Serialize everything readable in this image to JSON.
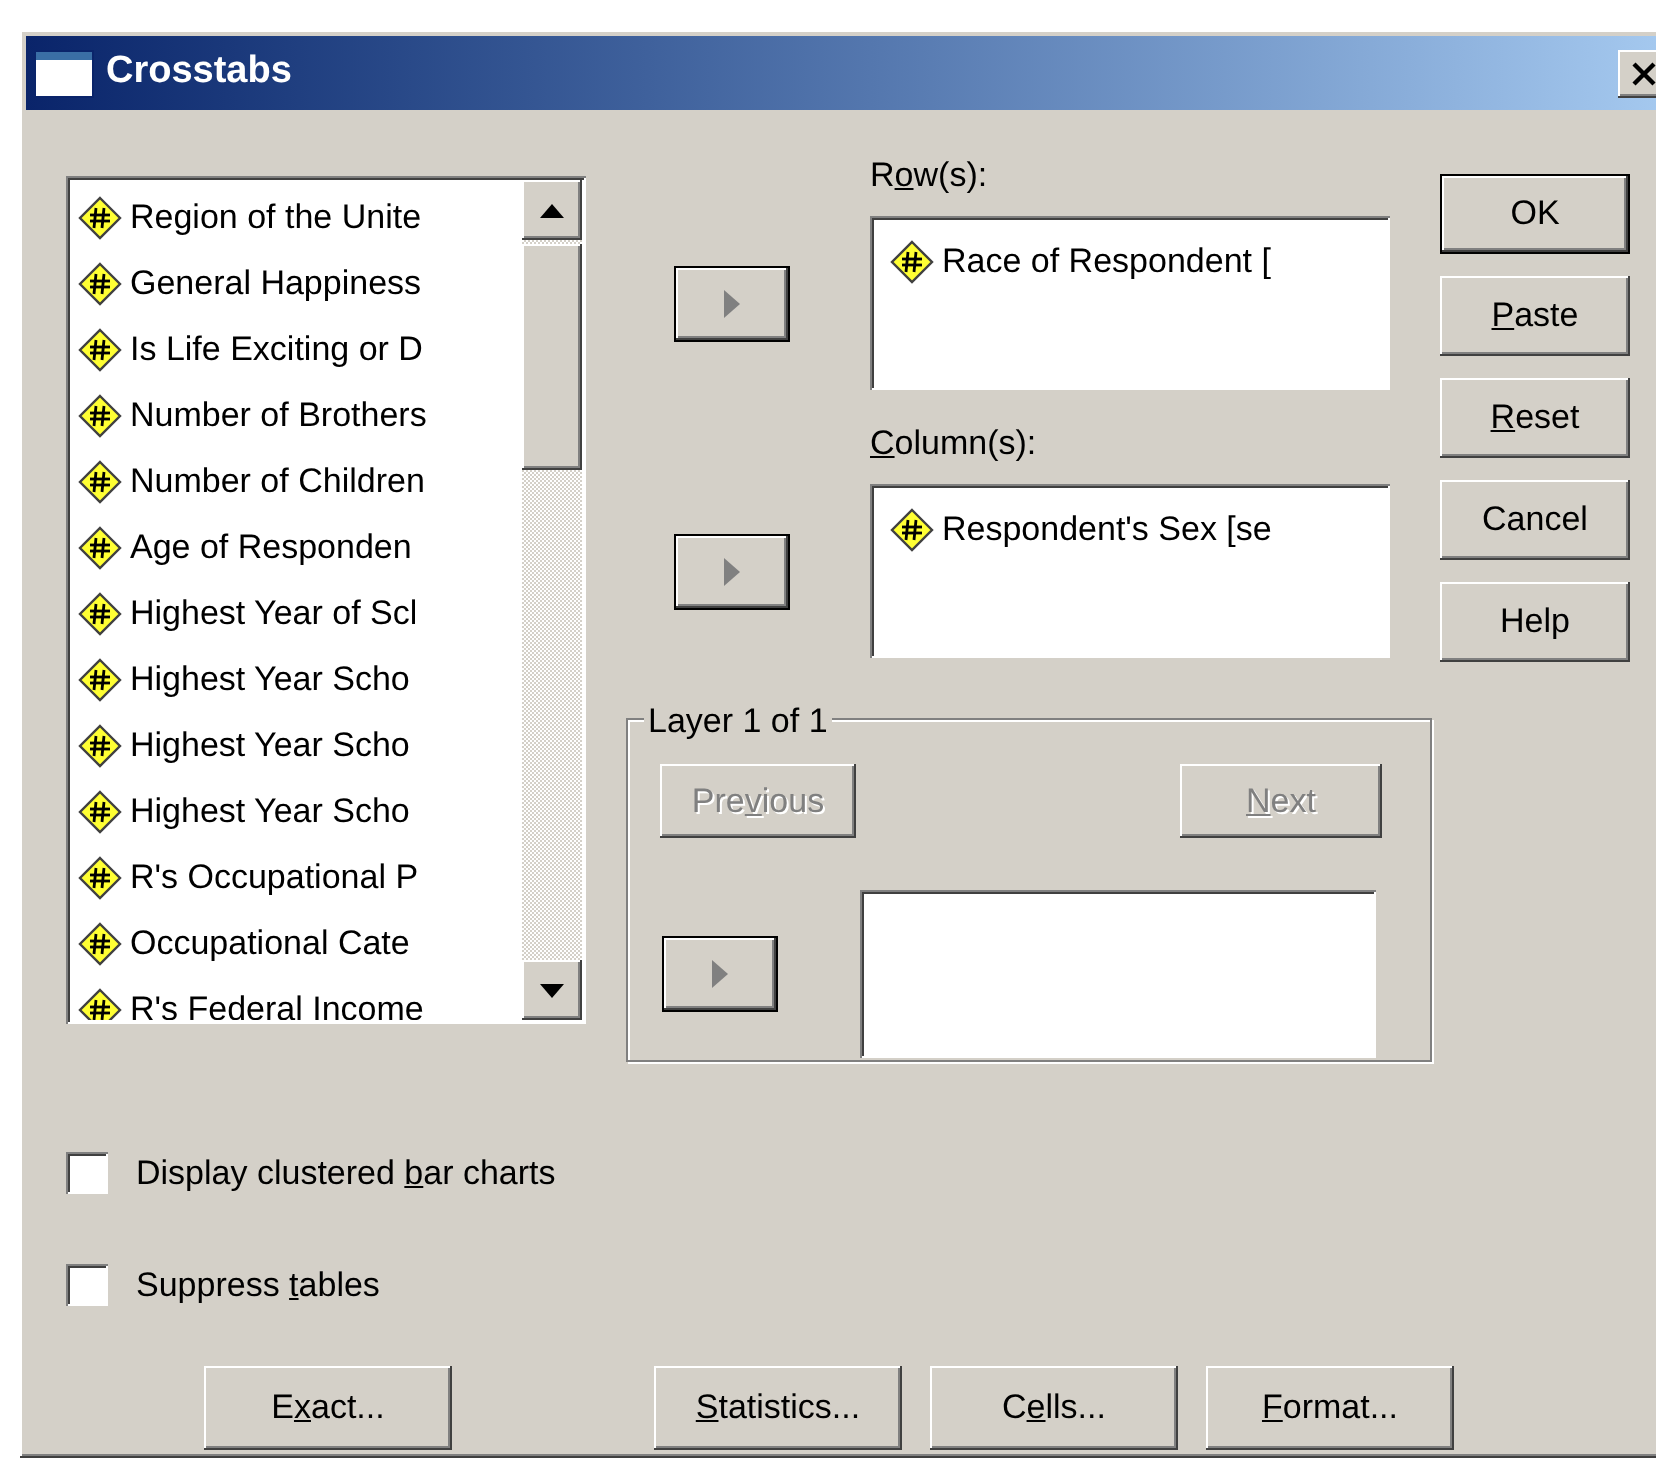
{
  "window": {
    "title": "Crosstabs"
  },
  "variables": [
    {
      "label": "Region of the Unite"
    },
    {
      "label": "General Happiness"
    },
    {
      "label": "Is Life Exciting or D"
    },
    {
      "label": "Number of Brothers"
    },
    {
      "label": "Number of Children"
    },
    {
      "label": "Age of Responden"
    },
    {
      "label": "Highest Year of Scl"
    },
    {
      "label": "Highest Year Scho"
    },
    {
      "label": "Highest Year Scho"
    },
    {
      "label": "Highest Year Scho"
    },
    {
      "label": "R's Occupational P"
    },
    {
      "label": "Occupational Cate"
    },
    {
      "label": "R's Federal Income"
    }
  ],
  "rows": {
    "label": {
      "before": "R",
      "key": "o",
      "after": "w(s):"
    },
    "arrow_disabled": true,
    "items": [
      "Race of Respondent ["
    ]
  },
  "columns": {
    "label": {
      "key": "C",
      "after": "olumn(s):"
    },
    "arrow_disabled": true,
    "items": [
      "Respondent's Sex [se"
    ]
  },
  "layer": {
    "title": "Layer 1 of 1",
    "previous": {
      "label": {
        "before": "Pre",
        "key": "v",
        "after": "ious"
      },
      "disabled": true
    },
    "next": {
      "label": {
        "key": "N",
        "after": "ext"
      },
      "disabled": true
    },
    "arrow_disabled": true
  },
  "side_buttons": [
    {
      "label": {
        "before": "OK"
      },
      "default": true
    },
    {
      "label": {
        "key": "P",
        "after": "aste"
      },
      "default": false
    },
    {
      "label": {
        "key": "R",
        "after": "eset"
      },
      "default": false
    },
    {
      "label": {
        "before": "Cancel"
      },
      "default": false
    },
    {
      "label": {
        "before": "Help"
      },
      "default": false
    }
  ],
  "options": [
    {
      "label": {
        "before": "Display clustered ",
        "key": "b",
        "after": "ar charts"
      },
      "checked": false
    },
    {
      "label": {
        "before": "Suppress ",
        "key": "t",
        "after": "ables"
      },
      "checked": false
    }
  ],
  "bottom_buttons": [
    {
      "label": {
        "before": "E",
        "key": "x",
        "after": "act..."
      }
    },
    {
      "label": {
        "key": "S",
        "after": "tatistics..."
      }
    },
    {
      "label": {
        "before": "C",
        "key": "e",
        "after": "lls..."
      }
    },
    {
      "label": {
        "key": "F",
        "after": "ormat..."
      }
    }
  ]
}
